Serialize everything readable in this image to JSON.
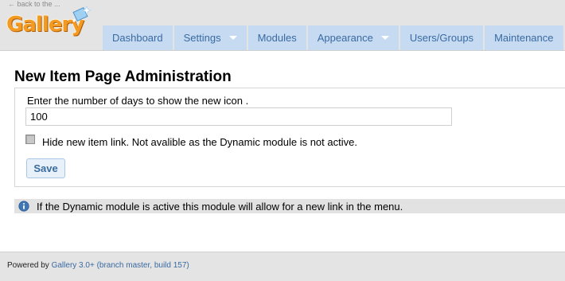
{
  "header": {
    "back_link": "← back to the ...",
    "logo_text": "Gallery"
  },
  "nav": {
    "items": [
      {
        "label": "Dashboard"
      },
      {
        "label": "Settings"
      },
      {
        "label": "Modules"
      },
      {
        "label": "Appearance"
      },
      {
        "label": "Users/Groups"
      },
      {
        "label": "Maintenance"
      }
    ]
  },
  "main": {
    "title": "New Item Page Administration",
    "days_label": "Enter the number of days to show the new icon .",
    "days_value": "100",
    "hide_label": "Hide new item link. Not avalible as the Dynamic module is not active.",
    "hide_checked": false,
    "save_label": "Save",
    "info_text": "If the Dynamic module is active this module will allow for a new link in the menu."
  },
  "footer": {
    "prefix": "Powered by ",
    "link": "Gallery 3.0+ (branch master, build 157)"
  },
  "colors": {
    "nav_bg": "#c6dbf2",
    "nav_text": "#3a6aa1",
    "header_bg": "#e4e4e4",
    "logo_orange": "#f39a22",
    "save_text": "#3b6c9e"
  }
}
